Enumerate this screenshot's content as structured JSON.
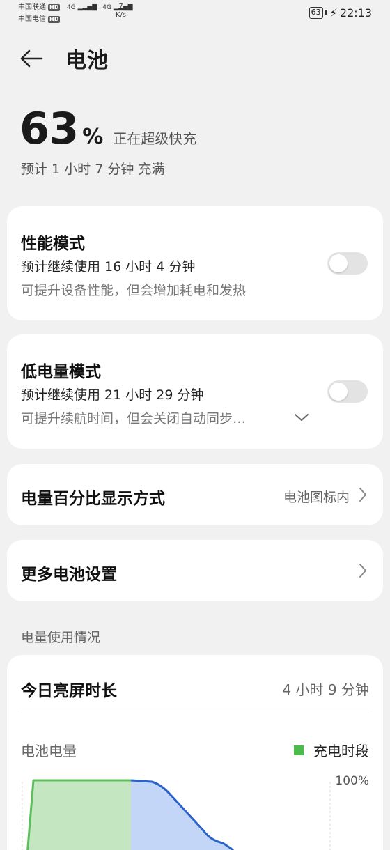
{
  "status_bar": {
    "carrier1": "中国联通",
    "carrier2": "中国电信",
    "hd": "HD",
    "net1": "4G",
    "net2": "4G",
    "speed_value": "7",
    "speed_unit": "K/s",
    "battery": "63",
    "time": "22:13"
  },
  "header": {
    "title": "电池"
  },
  "battery": {
    "percent": "63",
    "percent_sign": "%",
    "status": "正在超级快充",
    "estimate": "预计 1 小时 7 分钟 充满"
  },
  "performance_mode": {
    "title": "性能模式",
    "line1": "预计继续使用 16 小时 4 分钟",
    "line2": "可提升设备性能，但会增加耗电和发热",
    "enabled": false
  },
  "low_power_mode": {
    "title": "低电量模式",
    "line1": "预计继续使用 21 小时 29 分钟",
    "line2": "可提升续航时间，但会关闭自动同步…",
    "enabled": false
  },
  "percent_display": {
    "title": "电量百分比显示方式",
    "value": "电池图标内"
  },
  "more_settings": {
    "title": "更多电池设置"
  },
  "usage": {
    "section_label": "电量使用情况",
    "screen_time_label": "今日亮屏时长",
    "screen_time_value": "4 小时 9 分钟",
    "chart_label": "电池电量",
    "legend_label": "充电时段",
    "legend_color": "#4cbb4c",
    "y_top_label": "100%"
  },
  "colors": {
    "accent_line": "#2a62c9",
    "charge_fill": "#c4e6c0",
    "usage_fill": "#c3d6f7"
  }
}
